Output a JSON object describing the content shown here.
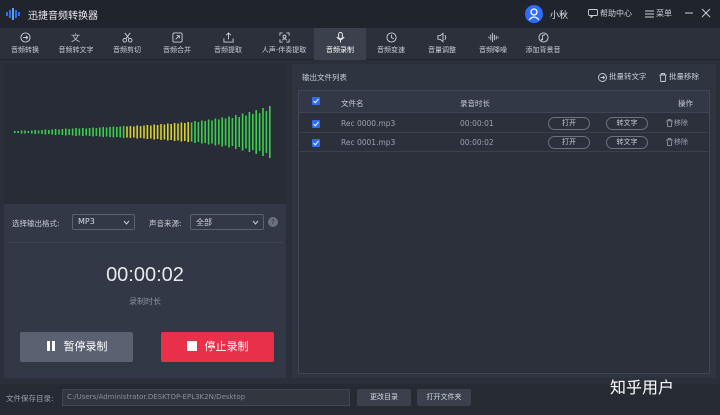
{
  "app": {
    "title": "迅捷音频转换器",
    "username": "小秋",
    "help_label": "帮助中心",
    "menu_label": "菜单"
  },
  "toolbar": [
    {
      "label": "音频转换",
      "icon": "convert-icon"
    },
    {
      "label": "音频转文字",
      "icon": "speech-to-text-icon"
    },
    {
      "label": "音频剪切",
      "icon": "scissors-icon"
    },
    {
      "label": "音频合并",
      "icon": "merge-icon"
    },
    {
      "label": "音频提取",
      "icon": "extract-icon"
    },
    {
      "label": "人声-伴奏提取",
      "icon": "vocal-icon"
    },
    {
      "label": "音频录制",
      "icon": "microphone-icon",
      "active": true
    },
    {
      "label": "音频变速",
      "icon": "speed-icon"
    },
    {
      "label": "音量调整",
      "icon": "volume-icon"
    },
    {
      "label": "音频降噪",
      "icon": "denoise-icon"
    },
    {
      "label": "添加背景音",
      "icon": "music-icon"
    }
  ],
  "recorder": {
    "format_label": "选择输出格式:",
    "format_value": "MP3",
    "source_label": "声音来源:",
    "source_value": "全部",
    "help_glyph": "?",
    "timer": "00:00:02",
    "timer_label": "录制时长",
    "pause_label": "暂停录制",
    "stop_label": "停止录制"
  },
  "file_list": {
    "title": "输出文件列表",
    "batch_text_label": "批量转文字",
    "batch_remove_label": "批量移除",
    "columns": {
      "name": "文件名",
      "duration": "录音时长",
      "actions": "操作"
    },
    "rows": [
      {
        "name": "Rec 0000.mp3",
        "duration": "00:00:01",
        "open": "打开",
        "to_text": "转文字",
        "remove": "移除"
      },
      {
        "name": "Rec 0001.mp3",
        "duration": "00:00:02",
        "open": "打开",
        "to_text": "转文字",
        "remove": "移除"
      }
    ]
  },
  "bottom": {
    "save_label": "文件保存目录:",
    "save_path": "C:/Users/Administrator.DESKTOP-EPL3K2N/Desktop",
    "change_dir": "更改目录",
    "open_folder": "打开文件夹"
  },
  "watermark": "知乎用户",
  "colors": {
    "accent": "#2f6bff",
    "stop": "#e8304a",
    "wave_green": "#3ccf4e",
    "wave_yellow": "#d8d030"
  }
}
